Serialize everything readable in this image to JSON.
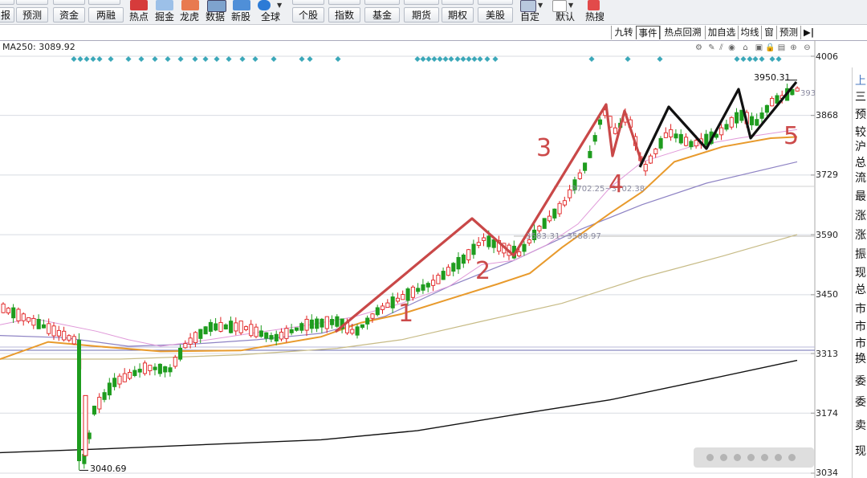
{
  "toolbar": {
    "row_stubs": [
      {
        "label": "",
        "name": "stub-1"
      },
      {
        "label": "",
        "name": "stub-2"
      }
    ],
    "buttons_row": [
      {
        "label": "报",
        "name": "report-button"
      },
      {
        "label": "预测",
        "name": "forecast-button"
      },
      {
        "label": "资金",
        "name": "capital-button"
      },
      {
        "label": "两融",
        "name": "margin-button"
      },
      {
        "label": "个股",
        "name": "stock-button"
      },
      {
        "label": "指数",
        "name": "index-button"
      },
      {
        "label": "基金",
        "name": "fund-button"
      },
      {
        "label": "期货",
        "name": "futures-button"
      },
      {
        "label": "期权",
        "name": "options-button"
      },
      {
        "label": "美股",
        "name": "us-stock-button"
      }
    ],
    "icon_items": [
      {
        "label": "热点",
        "icon": "hot-icon",
        "color": "#d63b3b"
      },
      {
        "label": "掘金",
        "icon": "dig-gold-icon",
        "color": "#2a6fc4"
      },
      {
        "label": "龙虎",
        "icon": "dragon-tiger-icon",
        "color": "#d2532d"
      },
      {
        "label": "数据",
        "icon": "data-icon",
        "color": "#3a6ea8"
      },
      {
        "label": "新股",
        "icon": "new-stock-icon",
        "color": "#3a7fd0"
      },
      {
        "label": "全球",
        "icon": "globe-icon",
        "color": "#2c7bd6"
      },
      {
        "label": "自定",
        "icon": "customize-icon",
        "color": "#5a7ab0"
      },
      {
        "label": "默认",
        "icon": "default-icon",
        "color": "#b33"
      },
      {
        "label": "热搜",
        "icon": "hot-search-icon",
        "color": "#e24a4a"
      }
    ]
  },
  "tabs": [
    "九转",
    "事件",
    "热点回溯",
    "加自选",
    "均线",
    "窗",
    "预测"
  ],
  "chart": {
    "ma_label": "MA250: 3089.92",
    "y_axis_labels": [
      "4006",
      "3868",
      "3729",
      "3590",
      "3450",
      "3313",
      "3174",
      "3034"
    ],
    "high_label": "3950.31",
    "low_label": "3040.69",
    "box_label_1": "3583.31~3588.97",
    "box_label_2": "3702.25~3702.38",
    "truncated_label": "393",
    "wave_labels": [
      "1",
      "2",
      "3",
      "4",
      "5"
    ],
    "colors": {
      "up": "#e02020",
      "down": "#1e9c1e",
      "annotation_red": "#c94848",
      "annotation_black": "#111111",
      "ma_orange": "#e89a2c",
      "ma_purple": "#8e83c4",
      "ma_pink": "#e099d9",
      "ma_olive": "#c7bb86",
      "marker": "#3ba8b9"
    }
  },
  "right_panel": [
    "上",
    "三",
    "预",
    "较",
    "沪",
    "总",
    "流",
    "最",
    "涨",
    "涨",
    "振",
    "现",
    "总",
    "市",
    "市",
    "市",
    "换",
    "委",
    "委",
    "卖",
    "现"
  ],
  "chart_data": {
    "type": "candlestick",
    "y_ticks": [
      4006,
      3868,
      3729,
      3590,
      3450,
      3313,
      3174,
      3034
    ],
    "ylim": [
      3034,
      4006
    ],
    "annotations": {
      "high": 3950.31,
      "low": 3040.69,
      "ma250": 3089.92
    },
    "wave_count_labels": [
      "1",
      "2",
      "3",
      "4",
      "5"
    ]
  }
}
